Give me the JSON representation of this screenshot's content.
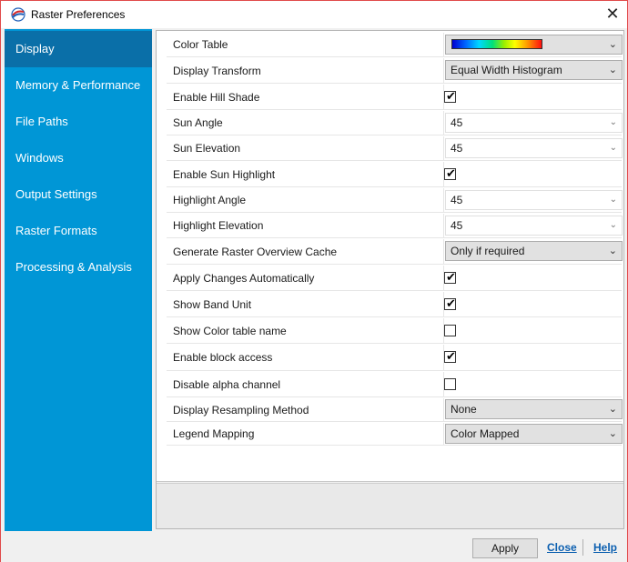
{
  "window": {
    "title": "Raster Preferences",
    "close_symbol": "✕"
  },
  "sidebar": {
    "items": [
      {
        "label": "Display",
        "active": true
      },
      {
        "label": "Memory & Performance"
      },
      {
        "label": "File Paths"
      },
      {
        "label": "Windows"
      },
      {
        "label": "Output Settings"
      },
      {
        "label": "Raster Formats"
      },
      {
        "label": "Processing & Analysis"
      }
    ]
  },
  "settings": {
    "color_table": {
      "label": "Color Table",
      "value_icon": "color-ramp-blue-to-red"
    },
    "display_transform": {
      "label": "Display Transform",
      "value": "Equal Width Histogram"
    },
    "enable_hill_shade": {
      "label": "Enable Hill Shade",
      "checked": true
    },
    "sun_angle": {
      "label": "Sun Angle",
      "value": "45"
    },
    "sun_elevation": {
      "label": "Sun Elevation",
      "value": "45"
    },
    "enable_sun_highlight": {
      "label": "Enable Sun Highlight",
      "checked": true
    },
    "highlight_angle": {
      "label": "Highlight Angle",
      "value": "45"
    },
    "highlight_elevation": {
      "label": "Highlight Elevation",
      "value": "45"
    },
    "generate_overview_cache": {
      "label": "Generate Raster Overview Cache",
      "value": "Only if required"
    },
    "apply_changes_automatically": {
      "label": "Apply Changes Automatically",
      "checked": true
    },
    "show_band_unit": {
      "label": "Show Band Unit",
      "checked": true
    },
    "show_color_table_name": {
      "label": "Show Color table name",
      "checked": false
    },
    "enable_block_access": {
      "label": "Enable block access",
      "checked": true
    },
    "disable_alpha_channel": {
      "label": "Disable alpha channel",
      "checked": false
    },
    "display_resampling_method": {
      "label": "Display Resampling Method",
      "value": "None"
    },
    "legend_mapping": {
      "label": "Legend Mapping",
      "value": "Color Mapped"
    }
  },
  "footer": {
    "apply_label": "Apply",
    "close_label": "Close",
    "help_label": "Help"
  },
  "symbols": {
    "dropdown": "⌄",
    "check": "✔"
  },
  "colors": {
    "sidebar_bg": "#0096d6",
    "sidebar_active": "#0a6fa8",
    "link": "#0b5fb0",
    "window_border": "#e04a4a"
  }
}
